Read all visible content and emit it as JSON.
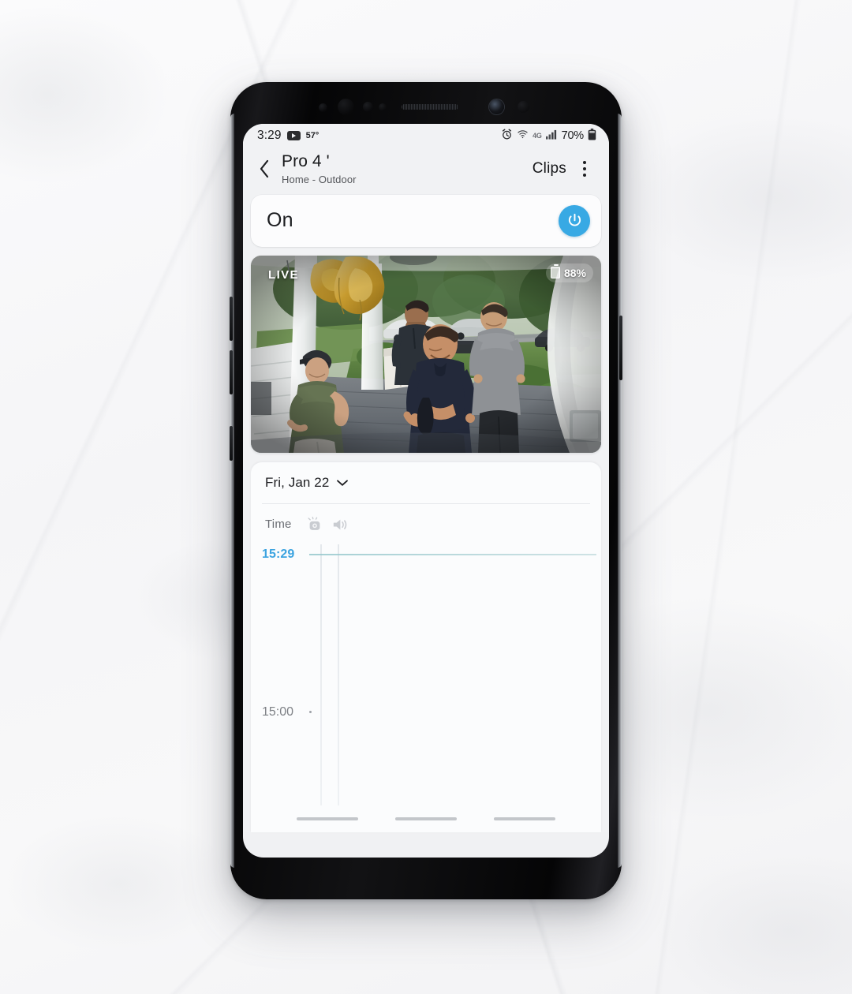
{
  "status_bar": {
    "time": "3:29",
    "notification_icon": "youtube-icon",
    "temperature": "57°",
    "alarm_icon": "alarm-clock-icon",
    "wifi_icon": "wifi-icon",
    "network_label": "4G",
    "signal_icon": "signal-bars-icon",
    "battery_percent": "70%",
    "battery_icon": "battery-icon"
  },
  "app_bar": {
    "back_icon": "chevron-left-icon",
    "title": "Pro 4 '",
    "subtitle": "Home - Outdoor",
    "clips_label": "Clips",
    "overflow_icon": "kebab-menu-icon"
  },
  "power_card": {
    "state_label": "On",
    "toggle_icon": "power-icon",
    "toggle_color": "#38a9e4"
  },
  "video": {
    "live_badge": "LIVE",
    "battery_badge": "88%",
    "battery_icon": "battery-icon",
    "description": "Fisheye doorbell camera view of four men standing on a front porch with gold balloons, trees, lawn and parked cars in the background"
  },
  "timeline": {
    "date_label": "Fri, Jan 22",
    "date_caret_icon": "chevron-down-icon",
    "time_column_header": "Time",
    "motion_icon": "motion-camera-icon",
    "sound_icon": "sound-speaker-icon",
    "current_time": "15:29",
    "current_time_color": "#3ba3e0",
    "past_time": "15:00"
  },
  "nav_bar": {
    "recents_label": "recents-pill",
    "home_label": "home-pill",
    "back_label": "back-pill"
  }
}
